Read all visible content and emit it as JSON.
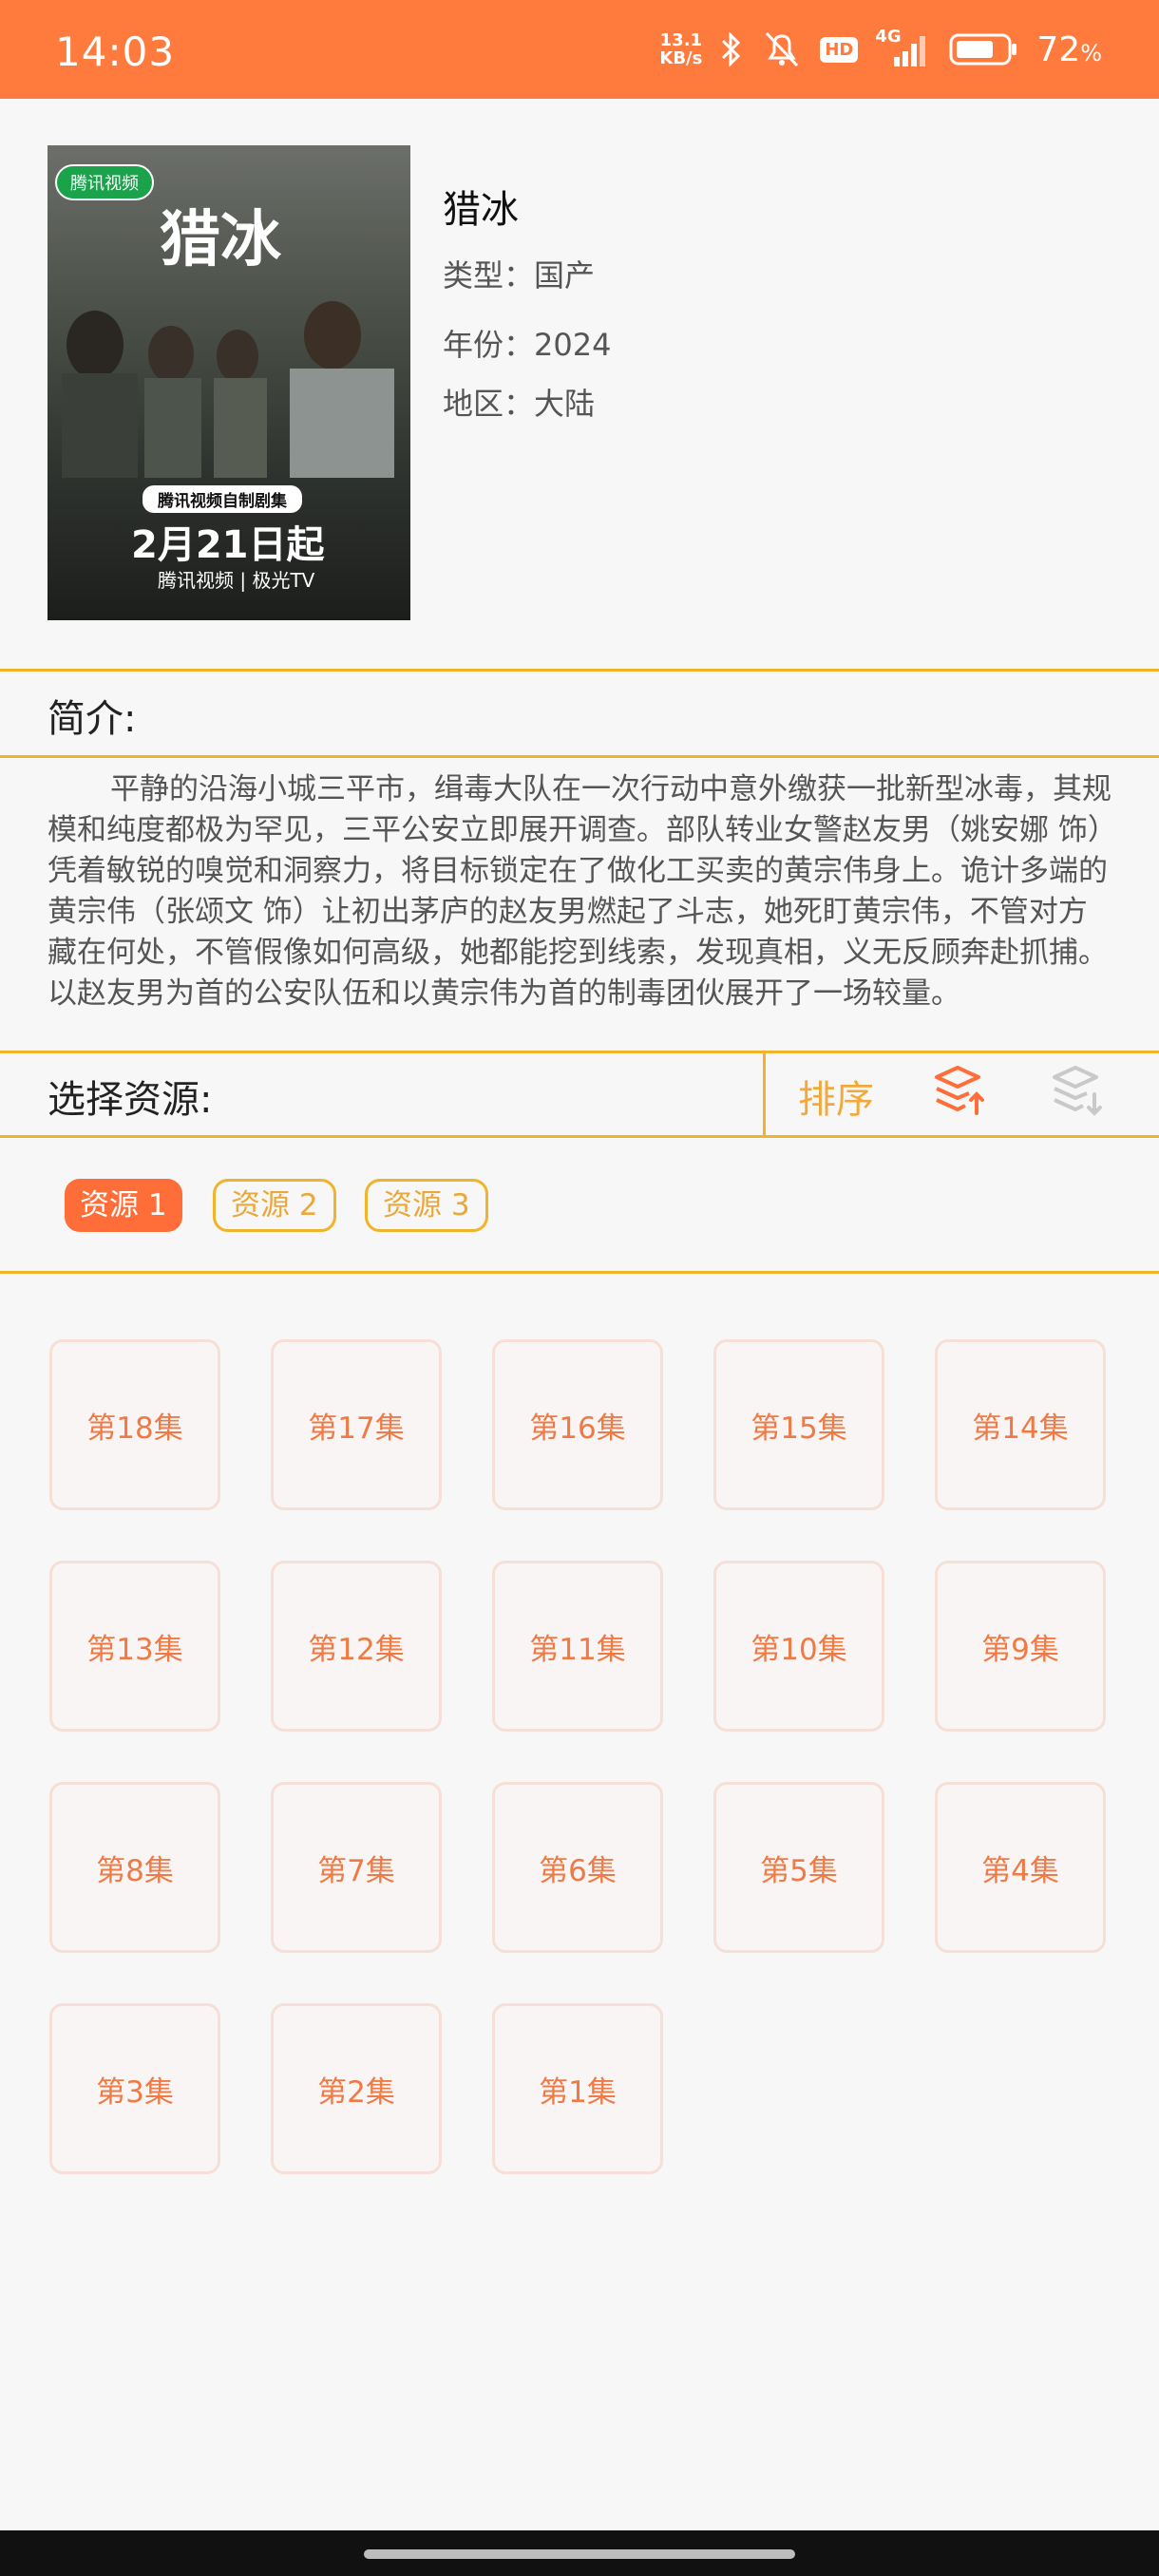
{
  "status_bar": {
    "time": "14:03",
    "speed_value": "13.1",
    "speed_unit": "KB/s",
    "network": "4G",
    "hd": "HD",
    "battery_pct": "72",
    "battery_unit": "%"
  },
  "detail": {
    "poster": {
      "tag": "腾讯视频",
      "title": "猎冰",
      "bar": "腾讯视频自制剧集",
      "date": "2月21日起",
      "logo": "腾讯视频 | 极光TV"
    },
    "title": "猎冰",
    "type": "类型：国产",
    "year": "年份：2024",
    "region": "地区：大陆"
  },
  "intro": {
    "label": "简介:",
    "text": "平静的沿海小城三平市，缉毒大队在一次行动中意外缴获一批新型冰毒，其规模和纯度都极为罕见，三平公安立即展开调查。部队转业女警赵友男（姚安娜 饰）凭着敏锐的嗅觉和洞察力，将目标锁定在了做化工买卖的黄宗伟身上。诡计多端的黄宗伟（张颂文 饰）让初出茅庐的赵友男燃起了斗志，她死盯黄宗伟，不管对方藏在何处，不管假像如何高级，她都能挖到线索，发现真相，义无反顾奔赴抓捕。 以赵友男为首的公安队伍和以黄宗伟为首的制毒团伙展开了一场较量。"
  },
  "source": {
    "label": "选择资源:",
    "sort_label": "排序",
    "sources": [
      "资源 1",
      "资源 2",
      "资源 3"
    ],
    "active_index": 0
  },
  "episodes": [
    "第18集",
    "第17集",
    "第16集",
    "第15集",
    "第14集",
    "第13集",
    "第12集",
    "第11集",
    "第10集",
    "第9集",
    "第8集",
    "第7集",
    "第6集",
    "第5集",
    "第4集",
    "第3集",
    "第2集",
    "第1集"
  ],
  "colors": {
    "accent": "#ff7a3d",
    "divider": "#f0b32a",
    "episode_text": "#f07a45"
  }
}
